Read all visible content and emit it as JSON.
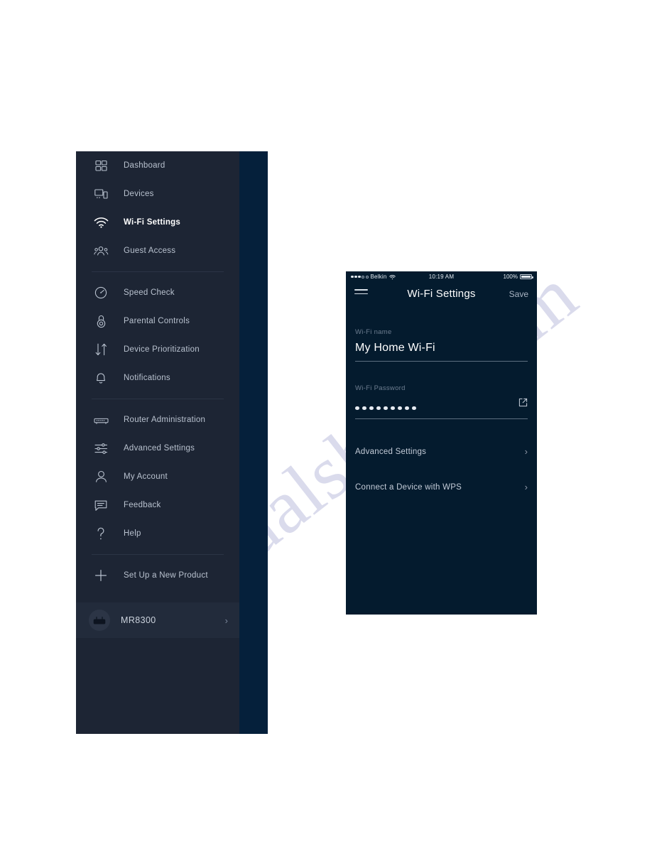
{
  "page": {
    "watermark_text": "manualshide.com",
    "background_color": "#ffffff"
  },
  "sidebar": {
    "panel_color": "#1d2534",
    "accent_panel_color": "#05203b",
    "hamburger_name": "hamburger-menu-icon",
    "items": [
      {
        "label": "Dashboard",
        "icon": "dashboard-icon",
        "active": false
      },
      {
        "label": "Devices",
        "icon": "devices-icon",
        "active": false
      },
      {
        "label": "Wi-Fi Settings",
        "icon": "wifi-icon",
        "active": true
      },
      {
        "label": "Guest Access",
        "icon": "guest-access-icon",
        "active": false
      },
      {
        "label": "Speed Check",
        "icon": "speedometer-icon",
        "active": false
      },
      {
        "label": "Parental Controls",
        "icon": "padlock-icon",
        "active": false
      },
      {
        "label": "Device Prioritization",
        "icon": "up-down-arrows-icon",
        "active": false
      },
      {
        "label": "Notifications",
        "icon": "bell-icon",
        "active": false
      },
      {
        "label": "Router Administration",
        "icon": "router-icon",
        "active": false
      },
      {
        "label": "Advanced Settings",
        "icon": "sliders-icon",
        "active": false
      },
      {
        "label": "My Account",
        "icon": "person-icon",
        "active": false
      },
      {
        "label": "Feedback",
        "icon": "speech-bubble-icon",
        "active": false
      },
      {
        "label": "Help",
        "icon": "question-mark-icon",
        "active": false
      },
      {
        "label": "Set Up a New Product",
        "icon": "plus-icon",
        "active": false
      }
    ],
    "device": {
      "name": "MR8300",
      "avatar_icon": "router-device-icon",
      "chevron": "›"
    }
  },
  "phone": {
    "screen_color": "#041b2e",
    "statusbar": {
      "carrier": "Belkin",
      "wifi_icon": "wifi-status-icon",
      "time": "10:19 AM",
      "battery_percent": "100%"
    },
    "header": {
      "menu_icon": "hamburger-menu-icon",
      "title": "Wi-Fi Settings",
      "save_label": "Save"
    },
    "fields": [
      {
        "label": "Wi-Fi name",
        "value": "My Home Wi-Fi",
        "type": "text"
      },
      {
        "label": "Wi-Fi Password",
        "value": "•••••••••",
        "dot_count": 9,
        "type": "password",
        "action_icon": "external-link-icon"
      }
    ],
    "nav_rows": [
      {
        "label": "Advanced Settings",
        "chevron": "›"
      },
      {
        "label": "Connect a Device with WPS",
        "chevron": "›"
      }
    ]
  }
}
